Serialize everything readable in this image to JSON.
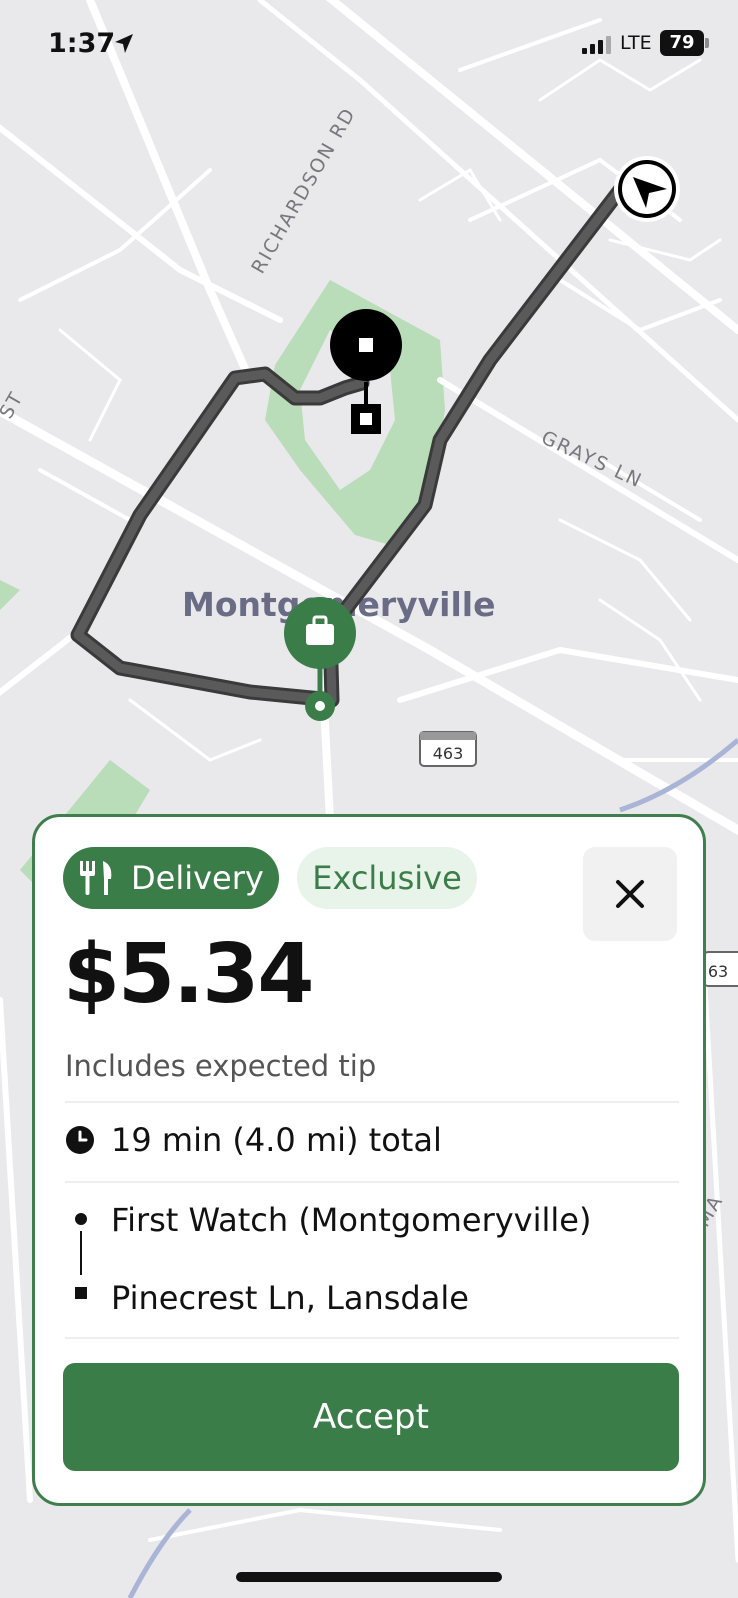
{
  "status_bar": {
    "time": "1:37",
    "network": "LTE",
    "battery": "79"
  },
  "map": {
    "street_labels": [
      "RICHARDSON RD",
      "GRAYS LN",
      "ST",
      "TMA"
    ],
    "place_label": "Montgomeryville",
    "route_shields": [
      "463",
      "63"
    ],
    "colors": {
      "background": "#e9e9ec",
      "road": "#ffffff",
      "park": "#b9dcb9",
      "route": "#444444",
      "pickup_marker": "#3a7d48",
      "water": "#aab4d6"
    }
  },
  "offer": {
    "delivery_label": "Delivery",
    "exclusive_label": "Exclusive",
    "price": "$5.34",
    "price_note": "Includes expected tip",
    "trip_total": "19 min (4.0 mi) total",
    "pickup": "First Watch (Montgomeryville)",
    "dropoff": "Pinecrest Ln, Lansdale",
    "accept_label": "Accept",
    "accent_color": "#3a7d48"
  },
  "icons": [
    "location-arrow-icon",
    "signal-icon",
    "battery-icon",
    "utensils-icon",
    "close-icon",
    "clock-icon",
    "bag-icon",
    "navigation-icon"
  ]
}
